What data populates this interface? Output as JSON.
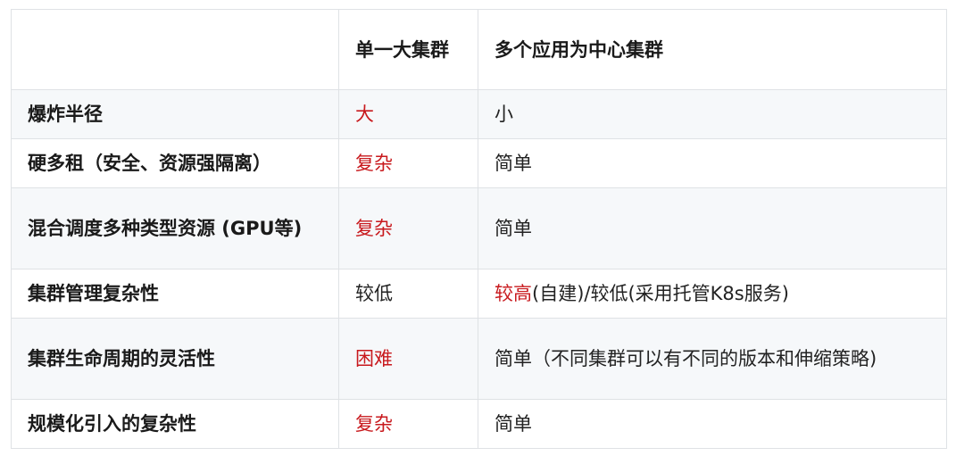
{
  "header": {
    "col1": "",
    "col2": "单一大集群",
    "col3": "多个应用为中心集群"
  },
  "rows": [
    {
      "label": "爆炸半径",
      "single": "大",
      "multi_red": "",
      "multi": "小"
    },
    {
      "label": "硬多租（安全、资源强隔离）",
      "single": "复杂",
      "multi_red": "",
      "multi": "简单"
    },
    {
      "label": "混合调度多种类型资源 (GPU等)",
      "single": "复杂",
      "multi_red": "",
      "multi": "简单"
    },
    {
      "label": "集群管理复杂性",
      "single": "较低",
      "multi_red": "较高",
      "multi": "(自建)/较低(采用托管K8s服务)"
    },
    {
      "label": "集群生命周期的灵活性",
      "single": "困难",
      "multi_red": "",
      "multi": "简单（不同集群可以有不同的版本和伸缩策略)"
    },
    {
      "label": "规模化引入的复杂性",
      "single": "复杂",
      "multi_red": "",
      "multi": "简单"
    }
  ],
  "colors": {
    "highlight_red": "#c8191d",
    "border": "#dfe2e5",
    "stripe": "#f6f8fa"
  }
}
